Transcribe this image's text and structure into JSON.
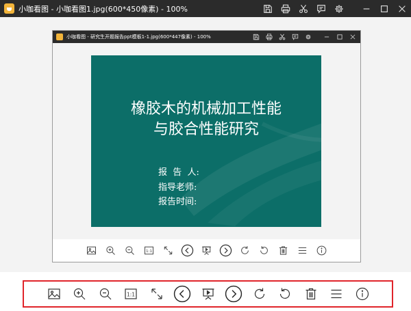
{
  "window": {
    "title": "小咖看图 - 小咖看图1.jpg(600*450像素) - 100%"
  },
  "inner_window": {
    "title": "小咖看图 - 研究生开题报告ppt模板1-1.jpg(600*447像素) - 100%"
  },
  "slide": {
    "title_line1": "橡胶木的机械加工性能",
    "title_line2": "与胶合性能研究",
    "reporter": "报  告  人:",
    "advisor": "指导老师:",
    "report_time": "报告时间:",
    "background_color": "#0c6e68"
  },
  "title_tools": [
    "save-icon",
    "print-icon",
    "cut-icon",
    "feedback-icon",
    "settings-icon",
    "minimize-icon",
    "maximize-icon",
    "close-icon"
  ],
  "toolbar": {
    "actual_size_label": "1:1",
    "tools": [
      "image-icon",
      "zoom-in-icon",
      "zoom-out-icon",
      "actual-size-icon",
      "fullscreen-icon",
      "previous-icon",
      "slideshow-icon",
      "next-icon",
      "rotate-right-icon",
      "rotate-left-icon",
      "delete-icon",
      "menu-icon",
      "info-icon"
    ]
  },
  "colors": {
    "titlebar": "#2b2b2b",
    "highlight_border": "#e0242a",
    "canvas": "#f3f3f3"
  }
}
